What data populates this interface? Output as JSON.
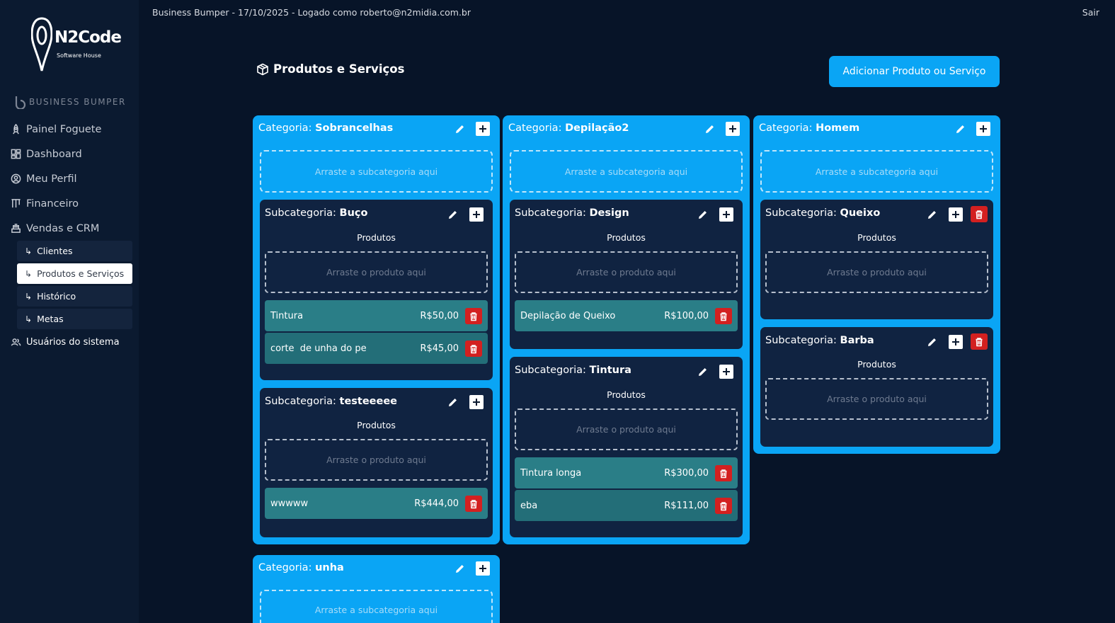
{
  "topbar": {
    "info": "Business Bumper - 17/10/2025 - Logado como roberto@n2midia.com.br",
    "logout": "Sair"
  },
  "logo": {
    "name": "N2Code",
    "tagline": "Software House"
  },
  "brand": "BUSINESS BUMPER",
  "nav": {
    "painel": "Painel Foguete",
    "dashboard": "Dashboard",
    "perfil": "Meu Perfil",
    "financeiro": "Financeiro",
    "vendas": "Vendas e CRM",
    "sub": [
      "Clientes",
      "Produtos e Serviços",
      "Histórico",
      "Metas"
    ],
    "usuarios": "Usuários do sistema"
  },
  "page": {
    "title": "Produtos e Serviços",
    "add_button": "Adicionar Produto ou Serviço"
  },
  "labels": {
    "categoria": "Categoria:",
    "subcategoria": "Subcategoria:",
    "produtos": "Produtos",
    "drop_sub": "Arraste a subcategoria aqui",
    "drop_prod": "Arraste o produto aqui"
  },
  "categories": [
    {
      "name": "Sobrancelhas",
      "subs": [
        {
          "name": "Buço",
          "products": [
            {
              "name": "Tintura",
              "price": "R$50,00"
            },
            {
              "name": "corte  de unha do pe",
              "price": "R$45,00"
            }
          ]
        },
        {
          "name": "testeeeee",
          "products": [
            {
              "name": "wwwww",
              "price": "R$444,00"
            }
          ]
        }
      ]
    },
    {
      "name": "Depilação2",
      "subs": [
        {
          "name": "Design",
          "products": [
            {
              "name": "Depilação de Queixo",
              "price": "R$100,00"
            }
          ]
        },
        {
          "name": "Tintura",
          "products": [
            {
              "name": "Tintura longa",
              "price": "R$300,00"
            },
            {
              "name": "eba",
              "price": "R$111,00"
            }
          ]
        }
      ]
    },
    {
      "name": "Homem",
      "subs": [
        {
          "name": "Queixo",
          "products": []
        },
        {
          "name": "Barba",
          "products": []
        }
      ]
    },
    {
      "name": "unha",
      "subs": []
    }
  ],
  "colors": {
    "background": "#071428",
    "sidebar": "#0b1a30",
    "accent": "#0aa5f5",
    "subcard": "#102341",
    "product": "#2a7e87",
    "danger": "#d32020"
  }
}
